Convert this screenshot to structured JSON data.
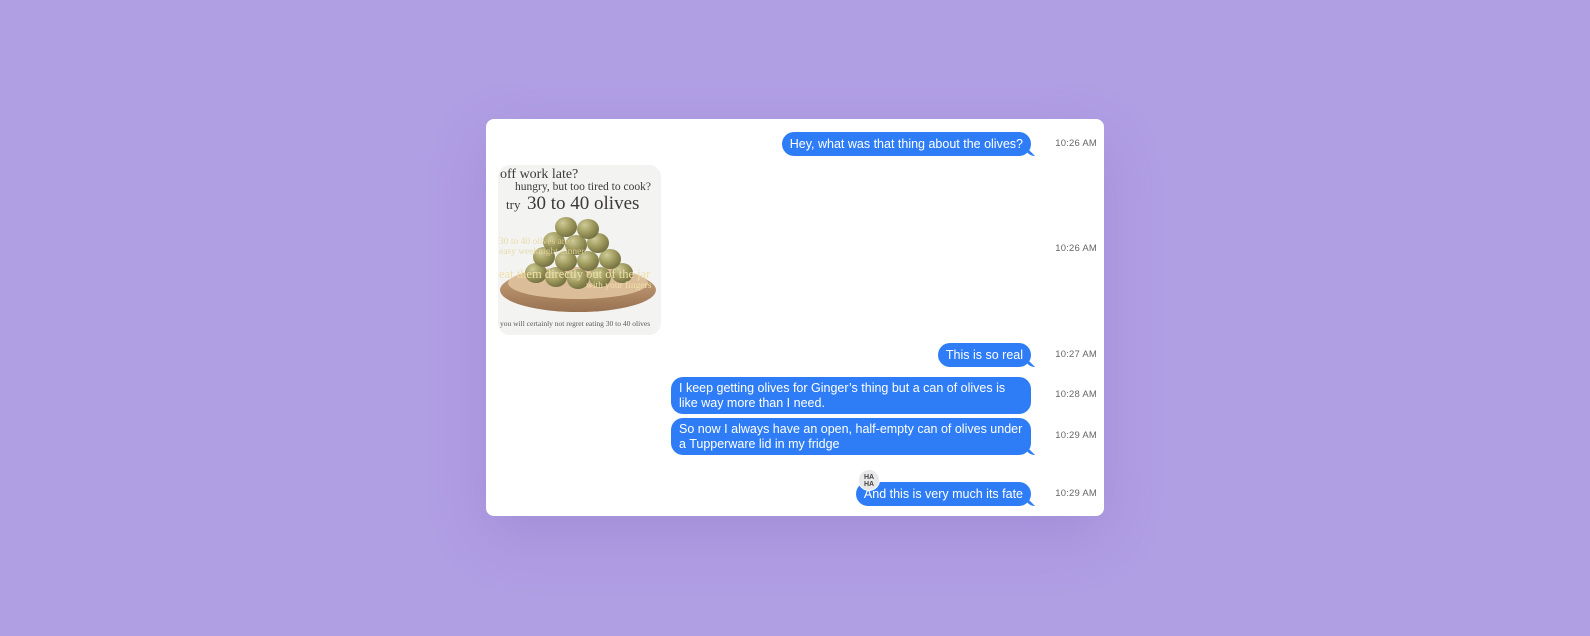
{
  "colors": {
    "background": "#b19fe4",
    "panel": "#ffffff",
    "sent_bubble": "#2f7df6",
    "bubble_text": "#ffffff",
    "timestamp": "#666666"
  },
  "messages": [
    {
      "type": "sent",
      "text": "Hey, what was that thing about the olives?",
      "time": "10:26 AM"
    },
    {
      "type": "received-image",
      "time": "10:26 AM",
      "image": {
        "line1": "off work late?",
        "line2": "hungry, but too tired to cook?",
        "line3_prefix": "try",
        "line3_main": "30 to 40 olives",
        "overlay1": "30 to 40 olives are",
        "overlay2": "easy weeknight dinner",
        "overlay3": "eat them directly out of the jar",
        "overlay4": "with your fingers",
        "footer": "you will certainly not regret eating 30 to 40 olives"
      }
    },
    {
      "type": "sent",
      "text": "This is so real",
      "time": "10:27 AM"
    },
    {
      "type": "sent",
      "text": "I keep getting olives for Ginger’s thing but a can of olives is like way more than I need.",
      "time": "10:28 AM"
    },
    {
      "type": "sent",
      "text": "So now I always have an open, half-empty can of olives under a Tupperware lid in my fridge",
      "time": "10:29 AM"
    },
    {
      "type": "sent",
      "text": "And this is very much its fate",
      "time": "10:29 AM",
      "tapback": "HA HA",
      "tapback_icon": "haha-tapback-icon"
    }
  ]
}
